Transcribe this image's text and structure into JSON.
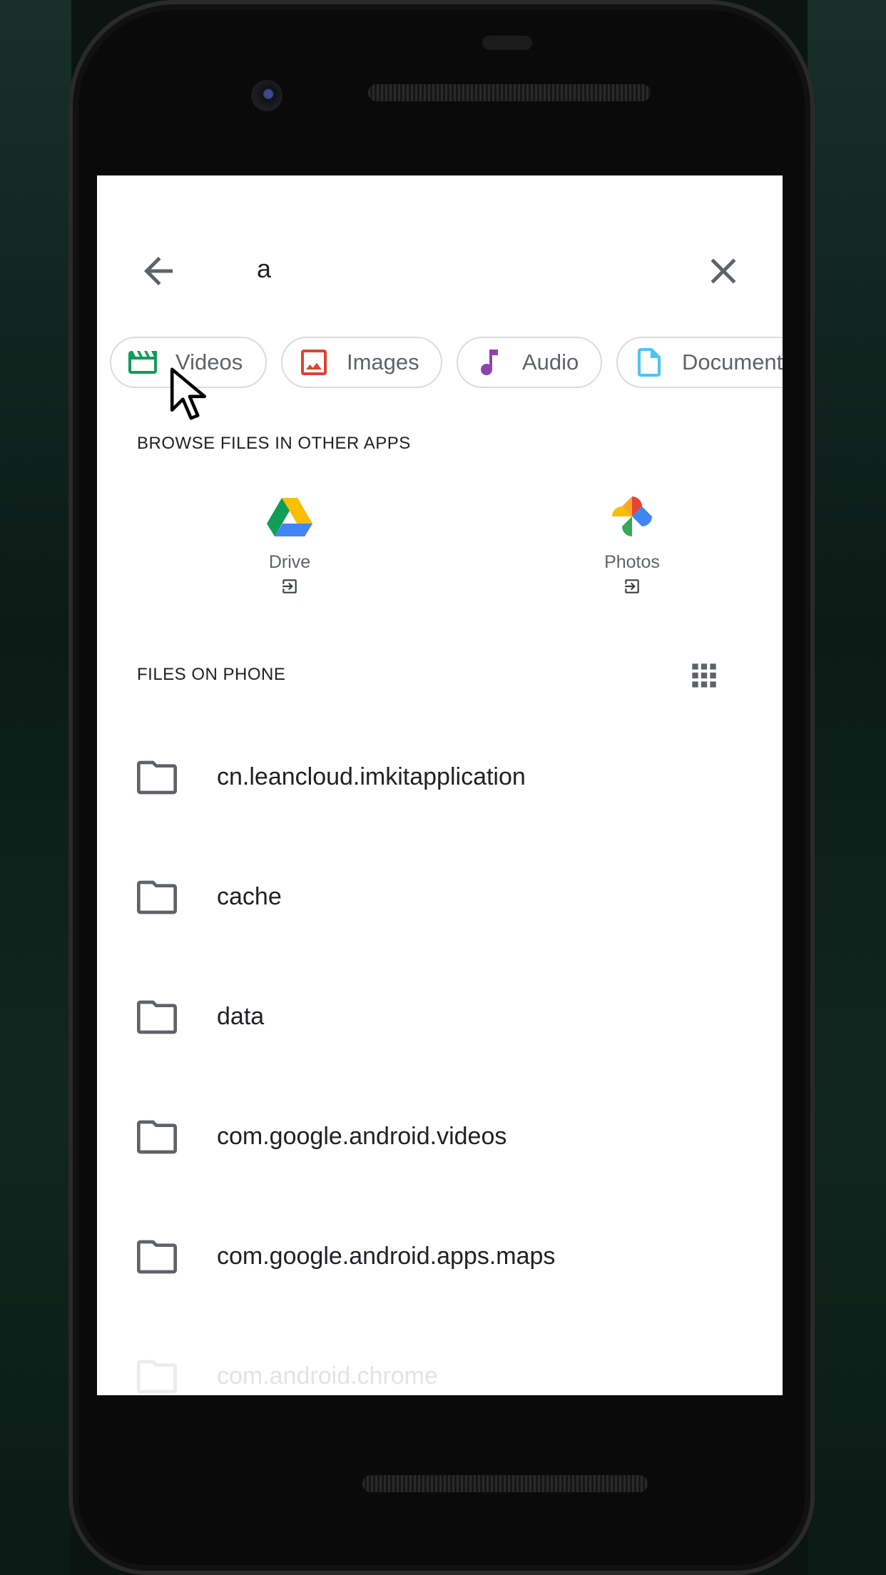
{
  "search": {
    "query": "a"
  },
  "chips": [
    {
      "label": "Videos",
      "icon": "video-icon",
      "color": "#0f9d58"
    },
    {
      "label": "Images",
      "icon": "image-icon",
      "color": "#db4437"
    },
    {
      "label": "Audio",
      "icon": "audio-icon",
      "color": "#8e44ad"
    },
    {
      "label": "Documents",
      "icon": "document-icon",
      "color": "#4fc3f7"
    }
  ],
  "browse": {
    "title": "BROWSE FILES IN OTHER APPS",
    "apps": [
      {
        "label": "Drive",
        "icon": "google-drive-icon"
      },
      {
        "label": "Photos",
        "icon": "google-photos-icon"
      }
    ]
  },
  "files": {
    "title": "FILES ON PHONE",
    "items": [
      {
        "name": "cn.leancloud.imkitapplication"
      },
      {
        "name": "cache"
      },
      {
        "name": "data"
      },
      {
        "name": "com.google.android.videos"
      },
      {
        "name": "com.google.android.apps.maps"
      },
      {
        "name": "com.android.chrome"
      }
    ]
  }
}
